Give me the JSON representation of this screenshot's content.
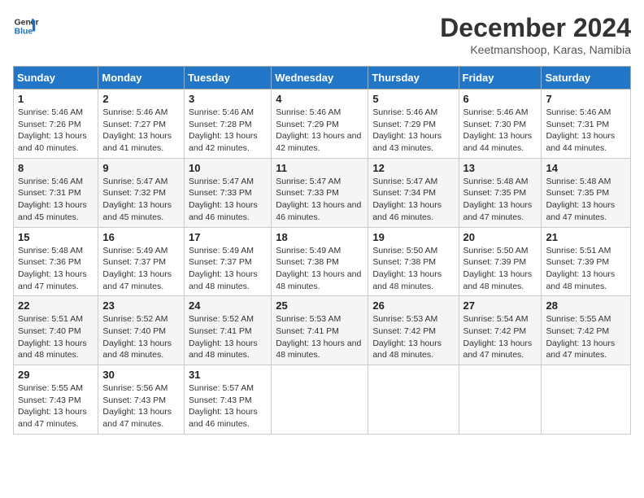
{
  "logo": {
    "line1": "General",
    "line2": "Blue"
  },
  "title": "December 2024",
  "location": "Keetmanshoop, Karas, Namibia",
  "weekdays": [
    "Sunday",
    "Monday",
    "Tuesday",
    "Wednesday",
    "Thursday",
    "Friday",
    "Saturday"
  ],
  "weeks": [
    [
      {
        "day": "1",
        "sunrise": "5:46 AM",
        "sunset": "7:26 PM",
        "daylight": "13 hours and 40 minutes."
      },
      {
        "day": "2",
        "sunrise": "5:46 AM",
        "sunset": "7:27 PM",
        "daylight": "13 hours and 41 minutes."
      },
      {
        "day": "3",
        "sunrise": "5:46 AM",
        "sunset": "7:28 PM",
        "daylight": "13 hours and 42 minutes."
      },
      {
        "day": "4",
        "sunrise": "5:46 AM",
        "sunset": "7:29 PM",
        "daylight": "13 hours and 42 minutes."
      },
      {
        "day": "5",
        "sunrise": "5:46 AM",
        "sunset": "7:29 PM",
        "daylight": "13 hours and 43 minutes."
      },
      {
        "day": "6",
        "sunrise": "5:46 AM",
        "sunset": "7:30 PM",
        "daylight": "13 hours and 44 minutes."
      },
      {
        "day": "7",
        "sunrise": "5:46 AM",
        "sunset": "7:31 PM",
        "daylight": "13 hours and 44 minutes."
      }
    ],
    [
      {
        "day": "8",
        "sunrise": "5:46 AM",
        "sunset": "7:31 PM",
        "daylight": "13 hours and 45 minutes."
      },
      {
        "day": "9",
        "sunrise": "5:47 AM",
        "sunset": "7:32 PM",
        "daylight": "13 hours and 45 minutes."
      },
      {
        "day": "10",
        "sunrise": "5:47 AM",
        "sunset": "7:33 PM",
        "daylight": "13 hours and 46 minutes."
      },
      {
        "day": "11",
        "sunrise": "5:47 AM",
        "sunset": "7:33 PM",
        "daylight": "13 hours and 46 minutes."
      },
      {
        "day": "12",
        "sunrise": "5:47 AM",
        "sunset": "7:34 PM",
        "daylight": "13 hours and 46 minutes."
      },
      {
        "day": "13",
        "sunrise": "5:48 AM",
        "sunset": "7:35 PM",
        "daylight": "13 hours and 47 minutes."
      },
      {
        "day": "14",
        "sunrise": "5:48 AM",
        "sunset": "7:35 PM",
        "daylight": "13 hours and 47 minutes."
      }
    ],
    [
      {
        "day": "15",
        "sunrise": "5:48 AM",
        "sunset": "7:36 PM",
        "daylight": "13 hours and 47 minutes."
      },
      {
        "day": "16",
        "sunrise": "5:49 AM",
        "sunset": "7:37 PM",
        "daylight": "13 hours and 47 minutes."
      },
      {
        "day": "17",
        "sunrise": "5:49 AM",
        "sunset": "7:37 PM",
        "daylight": "13 hours and 48 minutes."
      },
      {
        "day": "18",
        "sunrise": "5:49 AM",
        "sunset": "7:38 PM",
        "daylight": "13 hours and 48 minutes."
      },
      {
        "day": "19",
        "sunrise": "5:50 AM",
        "sunset": "7:38 PM",
        "daylight": "13 hours and 48 minutes."
      },
      {
        "day": "20",
        "sunrise": "5:50 AM",
        "sunset": "7:39 PM",
        "daylight": "13 hours and 48 minutes."
      },
      {
        "day": "21",
        "sunrise": "5:51 AM",
        "sunset": "7:39 PM",
        "daylight": "13 hours and 48 minutes."
      }
    ],
    [
      {
        "day": "22",
        "sunrise": "5:51 AM",
        "sunset": "7:40 PM",
        "daylight": "13 hours and 48 minutes."
      },
      {
        "day": "23",
        "sunrise": "5:52 AM",
        "sunset": "7:40 PM",
        "daylight": "13 hours and 48 minutes."
      },
      {
        "day": "24",
        "sunrise": "5:52 AM",
        "sunset": "7:41 PM",
        "daylight": "13 hours and 48 minutes."
      },
      {
        "day": "25",
        "sunrise": "5:53 AM",
        "sunset": "7:41 PM",
        "daylight": "13 hours and 48 minutes."
      },
      {
        "day": "26",
        "sunrise": "5:53 AM",
        "sunset": "7:42 PM",
        "daylight": "13 hours and 48 minutes."
      },
      {
        "day": "27",
        "sunrise": "5:54 AM",
        "sunset": "7:42 PM",
        "daylight": "13 hours and 47 minutes."
      },
      {
        "day": "28",
        "sunrise": "5:55 AM",
        "sunset": "7:42 PM",
        "daylight": "13 hours and 47 minutes."
      }
    ],
    [
      {
        "day": "29",
        "sunrise": "5:55 AM",
        "sunset": "7:43 PM",
        "daylight": "13 hours and 47 minutes."
      },
      {
        "day": "30",
        "sunrise": "5:56 AM",
        "sunset": "7:43 PM",
        "daylight": "13 hours and 47 minutes."
      },
      {
        "day": "31",
        "sunrise": "5:57 AM",
        "sunset": "7:43 PM",
        "daylight": "13 hours and 46 minutes."
      },
      null,
      null,
      null,
      null
    ]
  ]
}
